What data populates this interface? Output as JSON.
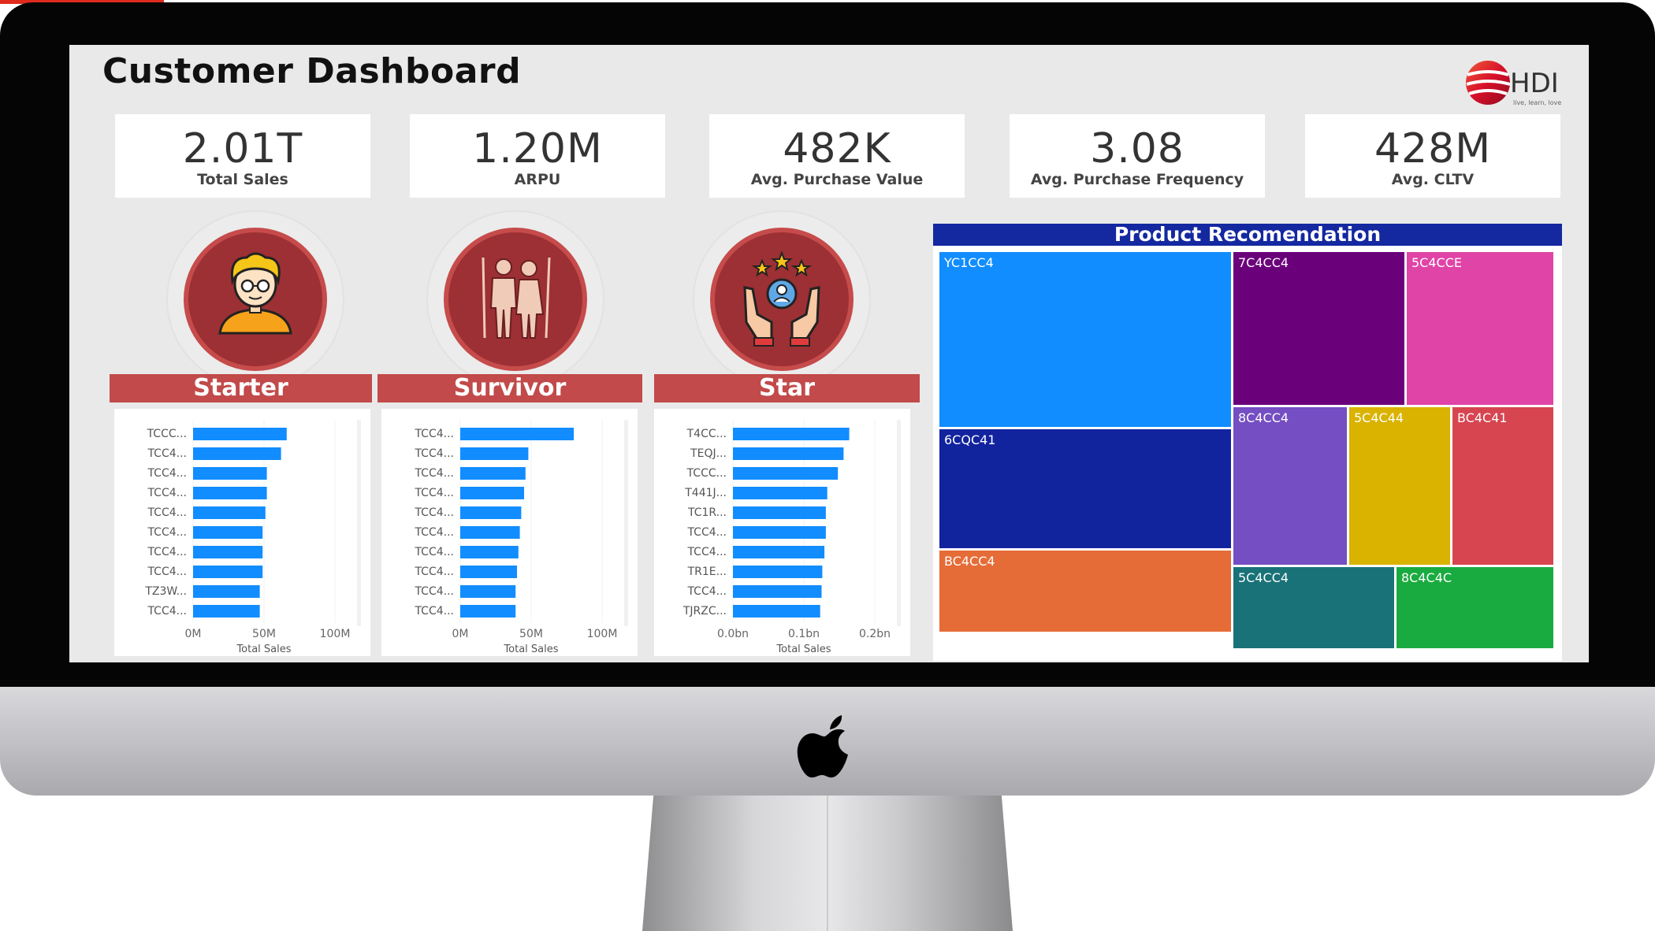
{
  "dashboard": {
    "title": "Customer Dashboard",
    "logo": {
      "name": "HDI",
      "tagline": "live, learn, love"
    }
  },
  "kpis": [
    {
      "value": "2.01T",
      "label": "Total Sales"
    },
    {
      "value": "1.20M",
      "label": "ARPU"
    },
    {
      "value": "482K",
      "label": "Avg. Purchase Value"
    },
    {
      "value": "3.08",
      "label": "Avg. Purchase Frequency"
    },
    {
      "value": "428M",
      "label": "Avg. CLTV"
    }
  ],
  "segments": [
    {
      "name": "Starter",
      "icon": "young-person-icon"
    },
    {
      "name": "Survivor",
      "icon": "couple-icon"
    },
    {
      "name": "Star",
      "icon": "star-customer-hands-icon"
    }
  ],
  "chart_data": [
    {
      "type": "bar",
      "orientation": "horizontal",
      "segment": "Starter",
      "categories": [
        "TCCC...",
        "TCC4...",
        "TCC4...",
        "TCC4...",
        "TCC4...",
        "TCC4...",
        "TCC4...",
        "TCC4...",
        "TZ3W...",
        "TCC4..."
      ],
      "values": [
        66,
        62,
        52,
        52,
        51,
        49,
        49,
        49,
        47,
        47
      ],
      "xlabel": "Total Sales",
      "xticks": [
        "0M",
        "50M",
        "100M"
      ],
      "xlim": [
        0,
        100
      ],
      "unit": "M",
      "color": "#118dff"
    },
    {
      "type": "bar",
      "orientation": "horizontal",
      "segment": "Survivor",
      "categories": [
        "TCC4...",
        "TCC4...",
        "TCC4...",
        "TCC4...",
        "TCC4...",
        "TCC4...",
        "TCC4...",
        "TCC4...",
        "TCC4...",
        "TCC4..."
      ],
      "values": [
        80,
        48,
        46,
        45,
        43,
        42,
        41,
        40,
        39,
        39
      ],
      "xlabel": "Total Sales",
      "xticks": [
        "0M",
        "50M",
        "100M"
      ],
      "xlim": [
        0,
        100
      ],
      "unit": "M",
      "color": "#118dff"
    },
    {
      "type": "bar",
      "orientation": "horizontal",
      "segment": "Star",
      "categories": [
        "T4CC...",
        "TEQJ...",
        "TCCC...",
        "T441J...",
        "TC1R...",
        "TCC4...",
        "TCC4...",
        "TR1E...",
        "TCC4...",
        "TJRZC..."
      ],
      "values": [
        0.164,
        0.156,
        0.148,
        0.133,
        0.131,
        0.131,
        0.129,
        0.126,
        0.125,
        0.123
      ],
      "xlabel": "Total Sales",
      "xticks": [
        "0.0bn",
        "0.1bn",
        "0.2bn"
      ],
      "xlim": [
        0,
        0.2
      ],
      "unit": "bn",
      "color": "#118dff"
    }
  ],
  "treemap": {
    "title": "Product Recomendation",
    "tiles": [
      {
        "label": "YC1CC4",
        "color": "#118dff"
      },
      {
        "label": "6CQC41",
        "color": "#12239e"
      },
      {
        "label": "BC4CC4",
        "color": "#e66c37"
      },
      {
        "label": "7C4CC4",
        "color": "#6b007b"
      },
      {
        "label": "5C4CCE",
        "color": "#e044a7"
      },
      {
        "label": "8C4CC4",
        "color": "#744ec2"
      },
      {
        "label": "5C4C44",
        "color": "#d9b300"
      },
      {
        "label": "BC4C41",
        "color": "#d64550"
      },
      {
        "label": "5C4CC4",
        "color": "#197278"
      },
      {
        "label": "8C4C4C",
        "color": "#1aab40"
      }
    ]
  }
}
